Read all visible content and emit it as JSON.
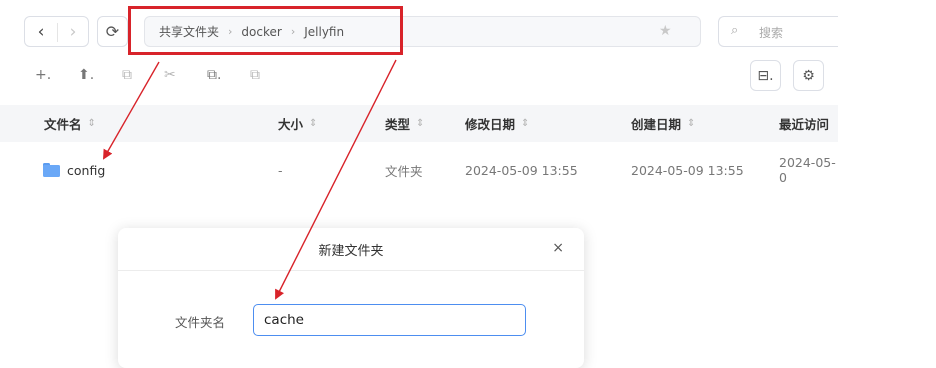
{
  "nav": {
    "back": "‹",
    "forward": "›",
    "refresh": "⟳"
  },
  "breadcrumb": [
    "共享文件夹",
    "docker",
    "Jellyfin"
  ],
  "search": {
    "placeholder": "搜索"
  },
  "toolbar": {
    "new_label": "+.",
    "upload_label": "⬆.",
    "copy_icon": "⧉",
    "cut_icon": "✂",
    "paste_label": "⧉.",
    "share_icon": "⧉",
    "view_label": "⊟.",
    "settings_icon": "⚙"
  },
  "table": {
    "columns": [
      "文件名",
      "大小",
      "类型",
      "修改日期",
      "创建日期",
      "最近访问"
    ],
    "rows": [
      {
        "name": "config",
        "size": "-",
        "type": "文件夹",
        "modified": "2024-05-09 13:55",
        "created": "2024-05-09 13:55",
        "accessed": "2024-05-0"
      }
    ]
  },
  "dialog": {
    "title": "新建文件夹",
    "field_label": "文件夹名",
    "field_value": "cache",
    "close": "×"
  },
  "colors": {
    "annotation": "#d8232a",
    "accent": "#4d8ef0",
    "folder": "#6aa8f7"
  }
}
